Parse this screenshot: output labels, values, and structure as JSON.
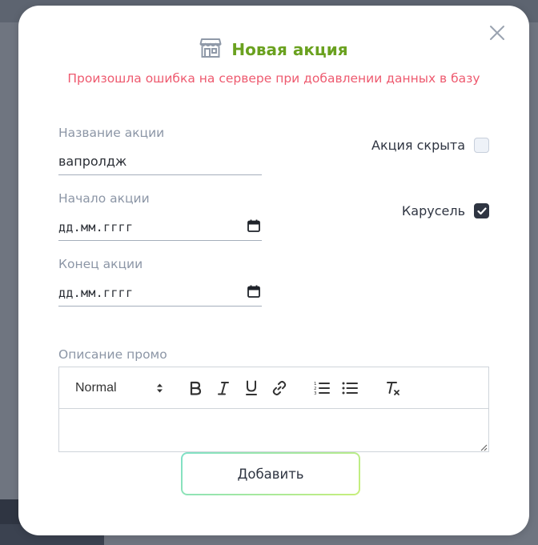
{
  "modal": {
    "title": "Новая акция",
    "error": "Произошла ошибка на сервере при добавлении данных в базу"
  },
  "fields": {
    "name": {
      "label": "Название акции",
      "value": "вапролдж"
    },
    "start": {
      "label": "Начало акции",
      "value": "дд.мм.гггг"
    },
    "end": {
      "label": "Конец акции",
      "value": "дд.мм.гггг"
    }
  },
  "checks": {
    "hidden": {
      "label": "Акция скрыта",
      "checked": false
    },
    "carousel": {
      "label": "Карусель",
      "checked": true
    }
  },
  "description": {
    "label": "Описание промо",
    "format_select": "Normal"
  },
  "submit_label": "Добавить",
  "colors": {
    "title": "#6aa11f",
    "error": "#ee5a6f",
    "checked": "#2f3542"
  }
}
